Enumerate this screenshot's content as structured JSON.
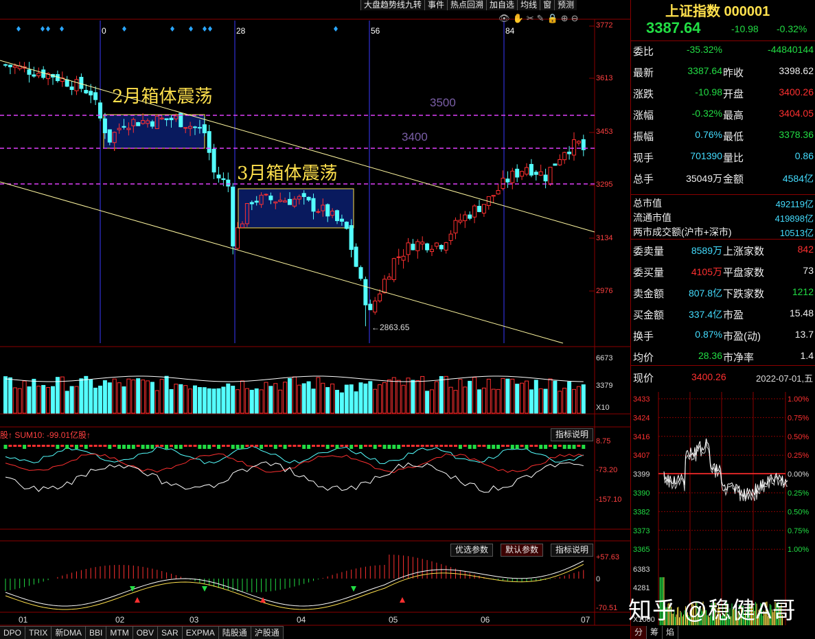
{
  "toolbar": {
    "items": [
      "大盘趋势线九转",
      "事件",
      "热点回溯",
      "加自选",
      "均线",
      "窗",
      "预测"
    ]
  },
  "chart": {
    "period_labels": [
      "0",
      "28",
      "56",
      "84"
    ],
    "annotations": {
      "feb_box": "2月箱体震荡",
      "mar_box": "3月箱体震荡",
      "level_3500": "3500",
      "level_3400": "3400",
      "low_label": "←2863.65"
    },
    "price_ticks": [
      "3772",
      "3613",
      "3453",
      "3295",
      "3134",
      "2976"
    ],
    "volume_ticks": [
      "6673",
      "3379",
      "X10"
    ],
    "indicator1": {
      "label": "股↑ SUM10: -99.01亿股↑",
      "button": "指标说明",
      "ticks": [
        "8.75",
        "-73.20",
        "-157.10"
      ]
    },
    "indicator2": {
      "buttons": [
        "优选参数",
        "默认参数",
        "指标说明"
      ],
      "ticks": [
        "+57.63",
        "0",
        "-70.51"
      ]
    },
    "month_labels": [
      "01",
      "02",
      "03",
      "04",
      "05",
      "06",
      "07"
    ],
    "bottom_tabs": [
      "DPO",
      "TRIX",
      "新DMA",
      "BBI",
      "MTM",
      "OBV",
      "SAR",
      "EXPMA",
      "陆股通",
      "沪股通"
    ]
  },
  "chart_data": {
    "type": "candlestick",
    "title": "上证指数 000001",
    "ylim": [
      2863.65,
      3772
    ],
    "low": 2863.65,
    "levels": [
      3500,
      3400,
      3295
    ],
    "x_months": [
      "01",
      "02",
      "03",
      "04",
      "05",
      "06",
      "07"
    ]
  },
  "quote": {
    "title": "上证指数 000001",
    "price": "3387.64",
    "change": "-10.98",
    "change_pct": "-0.32%",
    "rows": [
      {
        "l1": "委比",
        "v1": "-35.32%",
        "c1": "green",
        "l2": "",
        "v2": "-44840144",
        "c2": "green"
      },
      {
        "l1": "最新",
        "v1": "3387.64",
        "c1": "green",
        "l2": "昨收",
        "v2": "3398.62",
        "c2": "white"
      },
      {
        "l1": "涨跌",
        "v1": "-10.98",
        "c1": "green",
        "l2": "开盘",
        "v2": "3400.26",
        "c2": "red"
      },
      {
        "l1": "涨幅",
        "v1": "-0.32%",
        "c1": "green",
        "l2": "最高",
        "v2": "3404.05",
        "c2": "red"
      },
      {
        "l1": "振幅",
        "v1": "0.76%",
        "c1": "cyan",
        "l2": "最低",
        "v2": "3378.36",
        "c2": "green"
      },
      {
        "l1": "现手",
        "v1": "701390",
        "c1": "cyan",
        "l2": "量比",
        "v2": "0.86",
        "c2": "cyan"
      },
      {
        "l1": "总手",
        "v1": "35049万",
        "c1": "white",
        "l2": "金额",
        "v2": "4584亿",
        "c2": "cyan"
      }
    ],
    "mkt": [
      {
        "l": "总市值",
        "v": "492119亿"
      },
      {
        "l": "流通市值",
        "v": "419898亿"
      },
      {
        "l": "两市成交额(沪市+深市)",
        "v": "10513亿"
      }
    ],
    "rows2": [
      {
        "l1": "委卖量",
        "v1": "8589万",
        "c1": "cyan",
        "l2": "上涨家数",
        "v2": "842",
        "c2": "red"
      },
      {
        "l1": "委买量",
        "v1": "4105万",
        "c1": "red",
        "l2": "平盘家数",
        "v2": "73",
        "c2": "white"
      },
      {
        "l1": "卖金额",
        "v1": "807.8亿",
        "c1": "cyan",
        "l2": "下跌家数",
        "v2": "1212",
        "c2": "green"
      },
      {
        "l1": "买金额",
        "v1": "337.4亿",
        "c1": "cyan",
        "l2": "市盈",
        "v2": "15.48",
        "c2": "white"
      },
      {
        "l1": "换手",
        "v1": "0.87%",
        "c1": "cyan",
        "l2": "市盈(动)",
        "v2": "13.7",
        "c2": "white"
      },
      {
        "l1": "均价",
        "v1": "28.36",
        "c1": "green",
        "l2": "市净率",
        "v2": "1.4",
        "c2": "white"
      }
    ],
    "now_label": "现价",
    "now_value": "3400.26",
    "date": "2022-07-01,五",
    "mini_left_ticks": [
      "3433",
      "3424",
      "3416",
      "3407",
      "3399",
      "3390",
      "3382",
      "3373",
      "3365",
      "6383",
      "4281",
      "X1000"
    ],
    "mini_right_ticks": [
      "1.00%",
      "0.75%",
      "0.50%",
      "0.25%",
      "0.00%",
      "0.25%",
      "0.50%",
      "0.75%",
      "1.00%"
    ],
    "mini_tabs": [
      "分",
      "筹",
      "焰"
    ]
  },
  "watermark": "知乎 @稳健A哥",
  "colors": {
    "up": "#ff3030",
    "down": "#54ffff",
    "accent": "#ffe14d",
    "level": "#e040fb"
  }
}
